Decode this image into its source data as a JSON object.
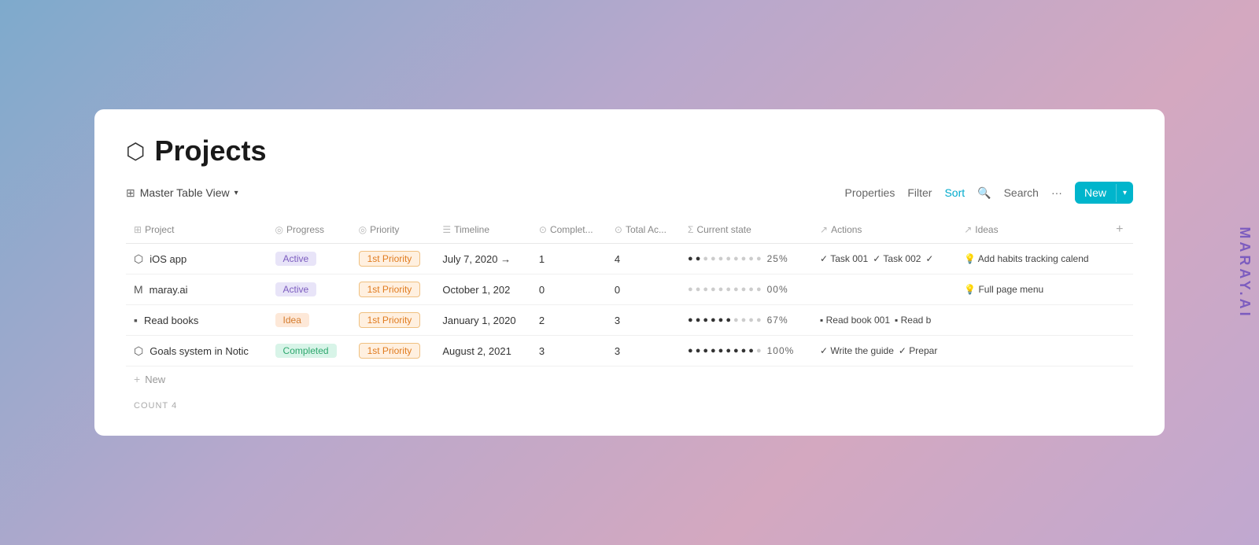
{
  "page": {
    "title": "Projects",
    "icon": "⬡",
    "watermark": "MARAY.AI"
  },
  "toolbar": {
    "view_label": "Master Table View",
    "view_icon": "⊞",
    "properties": "Properties",
    "filter": "Filter",
    "sort": "Sort",
    "search": "Search",
    "more": "···",
    "new_button": "New"
  },
  "columns": [
    {
      "id": "project",
      "icon": "⊞",
      "label": "Project"
    },
    {
      "id": "progress",
      "icon": "◎",
      "label": "Progress"
    },
    {
      "id": "priority",
      "icon": "◎",
      "label": "Priority"
    },
    {
      "id": "timeline",
      "icon": "☰",
      "label": "Timeline"
    },
    {
      "id": "completed",
      "icon": "⊙",
      "label": "Complet..."
    },
    {
      "id": "total_ac",
      "icon": "⊙",
      "label": "Total Ac..."
    },
    {
      "id": "current_state",
      "icon": "Σ",
      "label": "Current state"
    },
    {
      "id": "actions",
      "icon": "↗",
      "label": "Actions"
    },
    {
      "id": "ideas",
      "icon": "↗",
      "label": "Ideas"
    }
  ],
  "rows": [
    {
      "id": 1,
      "project_icon": "⬡",
      "project_name": "iOS app",
      "progress_badge": "Active",
      "progress_type": "active",
      "priority": "1st Priority",
      "timeline": "July 7, 2020 →",
      "completed": "1",
      "total_ac": "4",
      "dots_filled": 2,
      "dots_empty": 8,
      "percent": "25%",
      "actions": [
        "✓ Task 001",
        "✓ Task 002",
        "✓"
      ],
      "ideas": [
        "💡 Add habits tracking calend"
      ]
    },
    {
      "id": 2,
      "project_icon": "M",
      "project_name": "maray.ai",
      "progress_badge": "Active",
      "progress_type": "active",
      "priority": "1st Priority",
      "timeline": "October 1, 202",
      "completed": "0",
      "total_ac": "0",
      "dots_filled": 0,
      "dots_empty": 10,
      "percent": "00%",
      "actions": [],
      "ideas": [
        "💡 Full page menu"
      ]
    },
    {
      "id": 3,
      "project_icon": "▪",
      "project_name": "Read books",
      "progress_badge": "Idea",
      "progress_type": "idea",
      "priority": "1st Priority",
      "timeline": "January 1, 2020",
      "completed": "2",
      "total_ac": "3",
      "dots_filled": 6,
      "dots_empty": 4,
      "percent": "67%",
      "actions": [
        "▪ Read book 001",
        "▪ Read b"
      ],
      "ideas": []
    },
    {
      "id": 4,
      "project_icon": "⬡",
      "project_name": "Goals system in Notic",
      "progress_badge": "Completed",
      "progress_type": "completed",
      "priority": "1st Priority",
      "timeline": "August 2, 2021",
      "completed": "3",
      "total_ac": "3",
      "dots_filled": 9,
      "dots_empty": 1,
      "percent": "100%",
      "actions": [
        "✓ Write the guide",
        "✓ Prepar"
      ],
      "ideas": []
    }
  ],
  "footer": {
    "new_label": "New",
    "count_label": "COUNT",
    "count_value": "4"
  }
}
